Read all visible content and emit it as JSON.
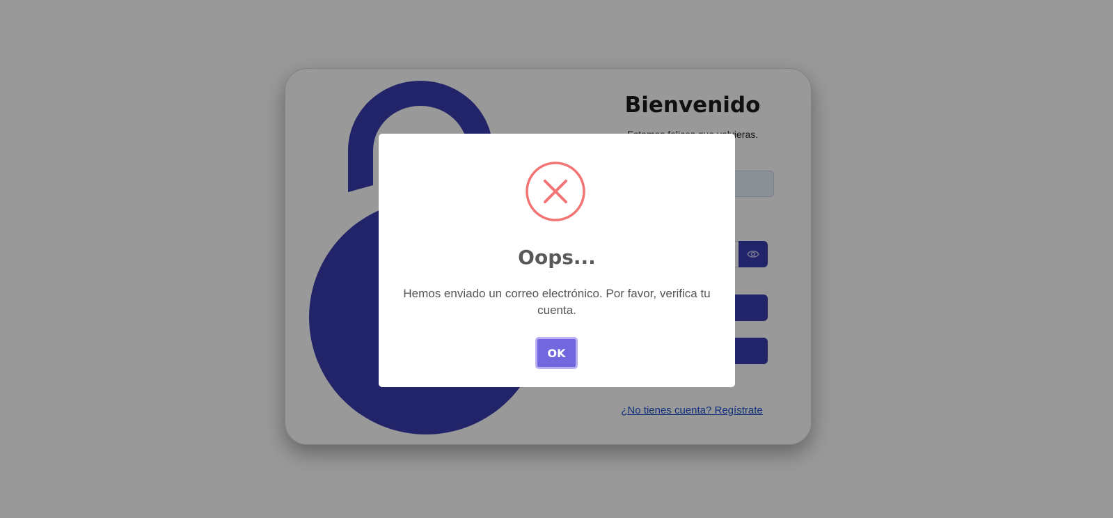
{
  "login": {
    "title": "Bienvenido",
    "subtitle": "Estamos felices que volvieras.",
    "email_value": "",
    "password_value": "",
    "login_button_label": "",
    "google_button_label": "",
    "register_link": "¿No tienes cuenta? Regístrate"
  },
  "modal": {
    "icon": "error-x-icon",
    "title": "Oops...",
    "message": "Hemos enviado un correo electrónico. Por favor, verifica tu cuenta.",
    "confirm_label": "OK"
  },
  "colors": {
    "brand": "#3a3db1",
    "error": "#f27474",
    "confirm_button": "#7367e0",
    "link": "#1a4fcf"
  }
}
